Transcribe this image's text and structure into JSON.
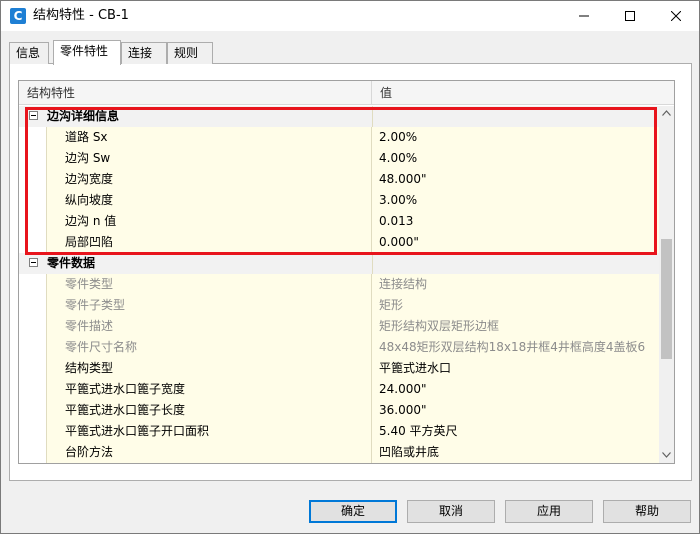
{
  "window": {
    "title": "结构特性 - CB-1",
    "icon": "C"
  },
  "tabs": [
    {
      "label": "信息"
    },
    {
      "label": "零件特性"
    },
    {
      "label": "连接"
    },
    {
      "label": "规则"
    }
  ],
  "grid": {
    "headers": {
      "name": "结构特性",
      "value": "值"
    },
    "categories": [
      {
        "label": "边沟详细信息",
        "rows": [
          {
            "name": "道路 Sx",
            "value": "2.00%"
          },
          {
            "name": "边沟 Sw",
            "value": "4.00%"
          },
          {
            "name": "边沟宽度",
            "value": "48.000\""
          },
          {
            "name": "纵向坡度",
            "value": "3.00%"
          },
          {
            "name": "边沟 n 值",
            "value": "0.013"
          },
          {
            "name": "局部凹陷",
            "value": "0.000\""
          }
        ]
      },
      {
        "label": "零件数据",
        "rows": [
          {
            "name": "零件类型",
            "value": "连接结构"
          },
          {
            "name": "零件子类型",
            "value": "矩形"
          },
          {
            "name": "零件描述",
            "value": "矩形结构双层矩形边框"
          },
          {
            "name": "零件尺寸名称",
            "value": "48x48矩形双层结构18x18井框4井框高度4盖板6"
          },
          {
            "name": "结构类型",
            "value": "平篦式进水口"
          },
          {
            "name": "平篦式进水口篦子宽度",
            "value": "24.000\""
          },
          {
            "name": "平篦式进水口篦子长度",
            "value": "36.000\""
          },
          {
            "name": "平篦式进水口篦子开口面积",
            "value": "5.40 平方英尺"
          },
          {
            "name": "台阶方法",
            "value": "凹陷或井底"
          }
        ]
      }
    ]
  },
  "buttons": {
    "ok": "确定",
    "cancel": "取消",
    "apply": "应用",
    "help": "帮助"
  },
  "colors": {
    "highlight": "#e8141c",
    "row_bg": "#fffde8",
    "accent": "#0078d7"
  }
}
